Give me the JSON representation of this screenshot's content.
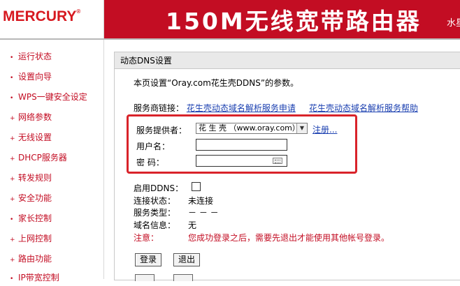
{
  "header": {
    "logo": "MERCURY",
    "logo_reg": "®",
    "title": "150M无线宽带路由器",
    "subtitle": "水星"
  },
  "sidebar": {
    "items": [
      {
        "label": "运行状态"
      },
      {
        "label": "设置向导"
      },
      {
        "label": "WPS一键安全设定"
      },
      {
        "label": "网络参数"
      },
      {
        "label": "无线设置"
      },
      {
        "label": "DHCP服务器"
      },
      {
        "label": "转发规则"
      },
      {
        "label": "安全功能"
      },
      {
        "label": "家长控制"
      },
      {
        "label": "上网控制"
      },
      {
        "label": "路由功能"
      },
      {
        "label": "IP带宽控制"
      }
    ]
  },
  "panel": {
    "title": "动态DNS设置",
    "description": "本页设置“Oray.com花生壳DDNS”的参数。",
    "links_label": "服务商链接：",
    "link1": "花生壳动态域名解析服务申请",
    "link2": "花生壳动态域名解析服务帮助",
    "provider_label": "服务提供者：",
    "provider_value": "花 生 壳 （www.oray.com）",
    "register_link": "注册...",
    "username_label": "用户名：",
    "username_value": "",
    "password_label": "密  码：",
    "password_value": "",
    "enable_label": "启用DDNS：",
    "enable_checked": false,
    "conn_label": "连接状态：",
    "conn_value": "未连接",
    "service_label": "服务类型：",
    "service_value": "－ － －",
    "domain_label": "域名信息：",
    "domain_value": "无",
    "note_label": "注意：",
    "note_text": "您成功登录之后，需要先退出才能使用其他帐号登录。",
    "login_button": "登录",
    "logout_button": "退出"
  },
  "colors": {
    "brand_red": "#c30d23",
    "link_blue": "#1a3fb0",
    "highlight_red": "#d9232a"
  }
}
